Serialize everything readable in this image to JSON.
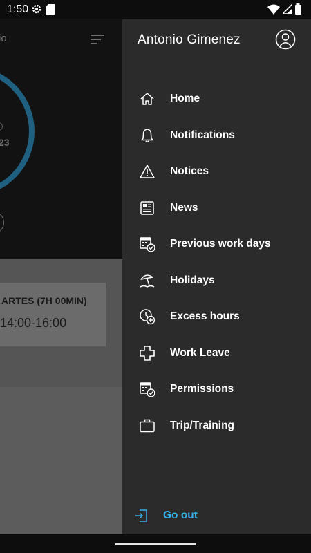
{
  "status_bar": {
    "time": "1:50",
    "icons": [
      "settings-icon",
      "sd-card-icon",
      "wifi-icon",
      "signal-icon",
      "battery-icon"
    ]
  },
  "background_app": {
    "title_fragment": "io",
    "ring_value_fragment": "23",
    "day_card": {
      "title": "ARTES (7H 00MIN)",
      "hours": "14:00-16:00"
    }
  },
  "drawer": {
    "user_name": "Antonio Gimenez",
    "menu": [
      {
        "label": "Home",
        "icon": "home-icon"
      },
      {
        "label": "Notifications",
        "icon": "bell-icon"
      },
      {
        "label": "Notices",
        "icon": "warning-icon"
      },
      {
        "label": "News",
        "icon": "newspaper-icon"
      },
      {
        "label": "Previous work days",
        "icon": "calendar-check-icon"
      },
      {
        "label": "Holidays",
        "icon": "beach-umbrella-icon"
      },
      {
        "label": "Excess hours",
        "icon": "clock-plus-icon"
      },
      {
        "label": "Work Leave",
        "icon": "medical-cross-icon"
      },
      {
        "label": "Permissions",
        "icon": "calendar-check-icon"
      },
      {
        "label": "Trip/Training",
        "icon": "briefcase-icon"
      }
    ],
    "logout_label": "Go out"
  },
  "colors": {
    "drawer_bg": "#2b2b2b",
    "accent": "#35aee6",
    "ring": "#1f5f7f"
  }
}
